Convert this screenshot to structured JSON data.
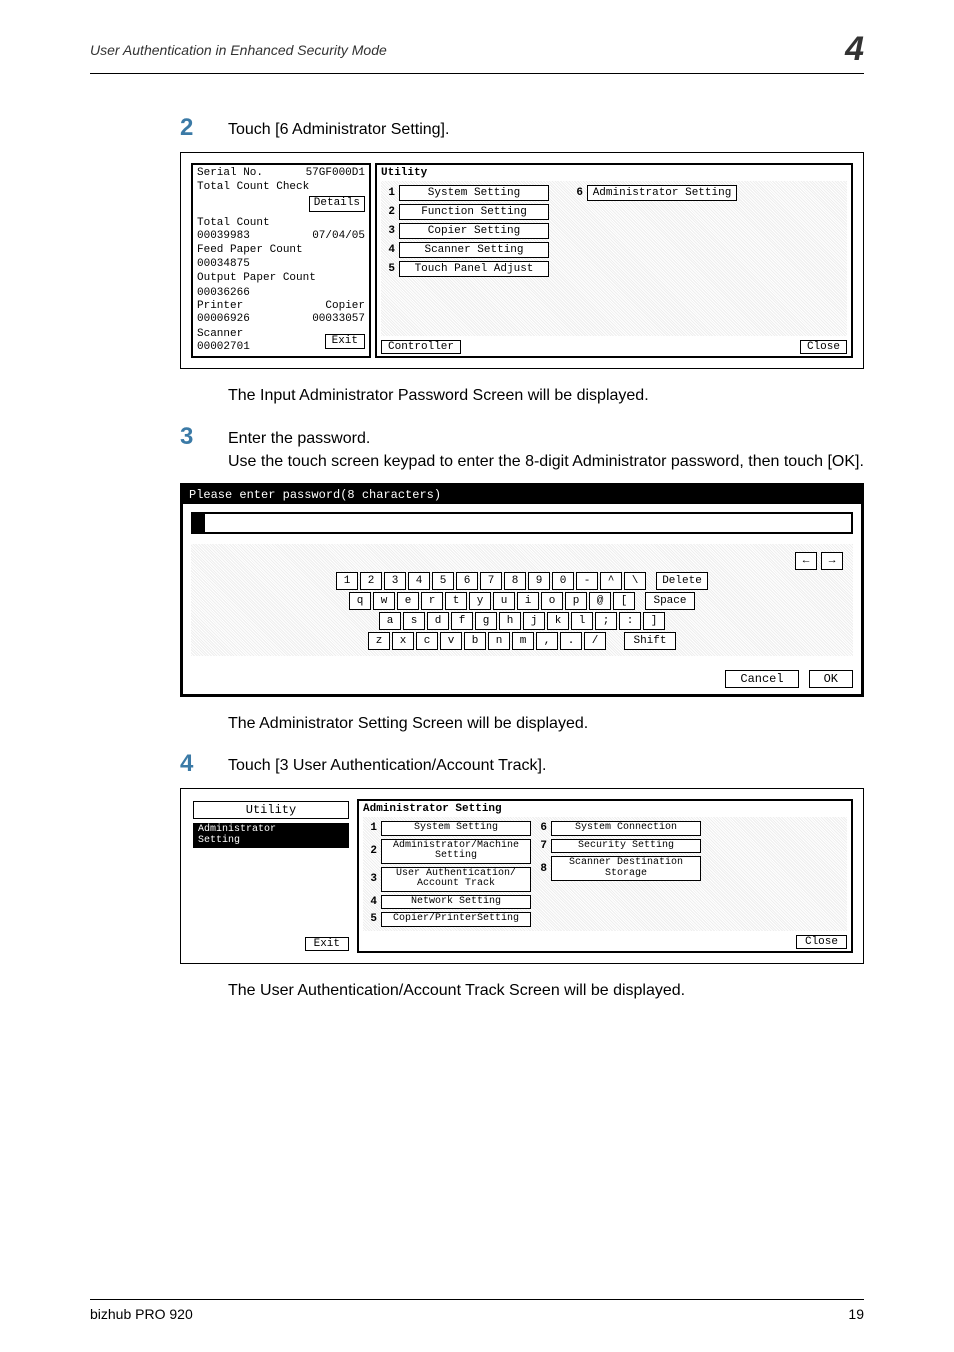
{
  "header": {
    "left": "User Authentication in Enhanced Security Mode",
    "right": "4"
  },
  "step2": {
    "num": "2",
    "text": "Touch [6 Administrator Setting]."
  },
  "screenshot1": {
    "left": {
      "serial_label": "Serial No.",
      "serial_value": "57GF000D1",
      "tcc": "Total Count Check",
      "details": "Details",
      "total_count": "Total Count",
      "total_value": "00039983",
      "date": "07/04/05",
      "feed_label": "Feed Paper Count",
      "feed_value": "00034875",
      "output_label": "Output Paper Count",
      "output_value": "00036266",
      "printer_label": "Printer",
      "copier_label": "Copier",
      "printer_value": "00006926",
      "copier_value": "00033057",
      "scanner_label": "Scanner",
      "scanner_value": "00002701",
      "exit": "Exit"
    },
    "right": {
      "title": "Utility",
      "items_left": [
        {
          "n": "1",
          "label": "System Setting"
        },
        {
          "n": "2",
          "label": "Function Setting"
        },
        {
          "n": "3",
          "label": "Copier Setting"
        },
        {
          "n": "4",
          "label": "Scanner Setting"
        },
        {
          "n": "5",
          "label": "Touch Panel Adjust"
        }
      ],
      "item6_n": "6",
      "item6_label": "Administrator Setting",
      "controller": "Controller",
      "close": "Close"
    }
  },
  "after1": "The Input Administrator Password Screen will be displayed.",
  "step3": {
    "num": "3",
    "line1": "Enter the password.",
    "line2": "Use the touch screen keypad to enter the 8-digit Administrator password, then touch [OK]."
  },
  "screenshot2": {
    "title": "Please enter password(8 characters)",
    "arrow_left": "←",
    "arrow_right": "→",
    "delete": "Delete",
    "row1": [
      "1",
      "2",
      "3",
      "4",
      "5",
      "6",
      "7",
      "8",
      "9",
      "0",
      "-",
      "^",
      "\\"
    ],
    "row2": [
      "q",
      "w",
      "e",
      "r",
      "t",
      "y",
      "u",
      "i",
      "o",
      "p",
      "@",
      "["
    ],
    "space": "Space",
    "row3": [
      "a",
      "s",
      "d",
      "f",
      "g",
      "h",
      "j",
      "k",
      "l",
      ";",
      ":",
      "]"
    ],
    "row4": [
      "z",
      "x",
      "c",
      "v",
      "b",
      "n",
      "m",
      ",",
      ".",
      "/"
    ],
    "shift": "Shift",
    "cancel": "Cancel",
    "ok": "OK"
  },
  "after2": "The Administrator Setting Screen will be displayed.",
  "step4": {
    "num": "4",
    "text": "Touch [3 User Authentication/Account Track]."
  },
  "screenshot3": {
    "left": {
      "utility": "Utility",
      "tab_line1": "Administrator",
      "tab_line2": "Setting",
      "exit": "Exit"
    },
    "right": {
      "title": "Administrator Setting",
      "col1": [
        {
          "n": "1",
          "label": "System Setting"
        },
        {
          "n": "2",
          "label": "Administrator/Machine\nSetting"
        },
        {
          "n": "3",
          "label": "User Authentication/\nAccount Track"
        },
        {
          "n": "4",
          "label": "Network Setting"
        },
        {
          "n": "5",
          "label": "Copier/PrinterSetting"
        }
      ],
      "col2": [
        {
          "n": "6",
          "label": "System Connection"
        },
        {
          "n": "7",
          "label": "Security Setting"
        },
        {
          "n": "8",
          "label": "Scanner Destination\nStorage"
        }
      ],
      "close": "Close"
    }
  },
  "after3": "The User Authentication/Account Track Screen will be displayed.",
  "footer": {
    "left": "bizhub PRO 920",
    "right": "19"
  }
}
